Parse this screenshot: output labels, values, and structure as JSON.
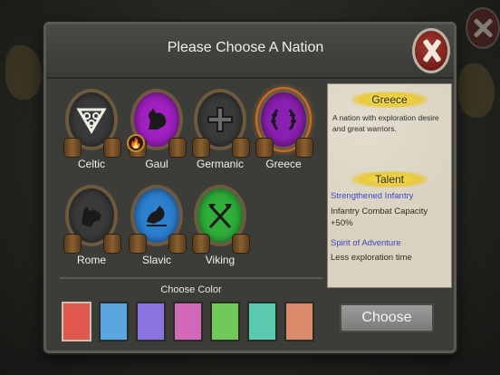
{
  "dialog": {
    "title": "Please Choose A Nation"
  },
  "nations": [
    {
      "label": "Celtic",
      "color": "#3a3a3a",
      "icon": "triquetra-icon"
    },
    {
      "label": "Gaul",
      "color": "#a020c0",
      "icon": "rooster-icon",
      "badge": "fire-icon"
    },
    {
      "label": "Germanic",
      "color": "#3a3a3a",
      "icon": "iron-cross-icon"
    },
    {
      "label": "Greece",
      "color": "#8a20b0",
      "icon": "laurel-wreath-icon",
      "selected": true
    },
    {
      "label": "Rome",
      "color": "#3a3a3a",
      "icon": "wolf-icon"
    },
    {
      "label": "Slavic",
      "color": "#2d7fd0",
      "icon": "bird-icon"
    },
    {
      "label": "Viking",
      "color": "#2fae3a",
      "icon": "crossed-axes-icon"
    }
  ],
  "info": {
    "nation_name": "Greece",
    "description": "A nation with exploration desire and great warriors.",
    "talent_title": "Talent",
    "talents": [
      {
        "name": "Strengthened Infantry",
        "desc": "Infantry Combat Capacity +50%"
      },
      {
        "name": "Spirit of Adventure",
        "desc": "Less exploration time"
      }
    ]
  },
  "colors": {
    "label": "Choose Color",
    "swatches": [
      "#e0584e",
      "#5aa6e0",
      "#8a72e0",
      "#d06ab8",
      "#6fca5a",
      "#5acab0",
      "#d88a6a"
    ],
    "selected_index": 0
  },
  "choose_button": "Choose"
}
